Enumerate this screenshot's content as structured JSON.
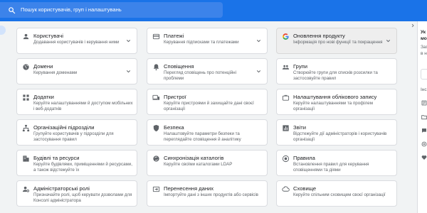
{
  "search": {
    "placeholder": "Пошук користувачів, груп і налаштувань",
    "icon": "search-icon"
  },
  "colors": {
    "header": "#1a73e8",
    "icon": "#5f6368",
    "highlight_card": "#eeeeee"
  },
  "cards": [
    {
      "title": "Користувачі",
      "description": "Додавання користувачів і керування ними",
      "icon": "person-icon",
      "expandable": true
    },
    {
      "title": "Платежі",
      "description": "Керування підписками та платежами",
      "icon": "credit-card-icon",
      "expandable": true
    },
    {
      "title": "Оновлення продукту",
      "description": "Інформація про нові функції та покращення",
      "icon": "google-logo-icon",
      "expandable": true,
      "highlighted": true
    },
    {
      "title": "Домени",
      "description": "Керування доменами",
      "icon": "globe-icon",
      "expandable": true
    },
    {
      "title": "Сповіщення",
      "description": "Перегляд сповіщень про потенційні проблеми",
      "icon": "bell-icon",
      "expandable": true
    },
    {
      "title": "Групи",
      "description": "Створюйте групи для списків розсилки та застосовуйте правил",
      "icon": "groups-icon",
      "expandable": false
    },
    {
      "title": "Додатки",
      "description": "Керуйте налаштуваннями й доступом мобільних і веб-додатків",
      "icon": "apps-grid-icon",
      "expandable": false
    },
    {
      "title": "Пристрої",
      "description": "Керуйте пристроями й захищайте дані своєї організації",
      "icon": "devices-icon",
      "expandable": false
    },
    {
      "title": "Налаштування облікового запису",
      "description": "Керуйте налаштуваннями та профілем організації",
      "icon": "briefcase-icon",
      "expandable": false
    },
    {
      "title": "Організаційні підрозділи",
      "description": "Групуйте користувачів у підрозділи для застосування правил",
      "icon": "org-chart-icon",
      "expandable": false
    },
    {
      "title": "Безпека",
      "description": "Налаштовуйте параметри безпеки та переглядайте сповіщення й аналітику",
      "icon": "shield-icon",
      "expandable": false
    },
    {
      "title": "Звіти",
      "description": "Відстежуйте дії адміністраторів і користувачів організації",
      "icon": "bar-chart-icon",
      "expandable": false
    },
    {
      "title": "Будівлі та ресурси",
      "description": "Керуйте будівлями, приміщеннями й ресурсами, а також відстежуйте їх",
      "icon": "building-icon",
      "expandable": false
    },
    {
      "title": "Синхронізація каталогів",
      "description": "Керуйте своїми каталогами LDAP",
      "icon": "sync-icon",
      "expandable": false
    },
    {
      "title": "Правила",
      "description": "Встановлення правил для керування сповіщеннями та діями",
      "icon": "rule-icon",
      "expandable": false
    },
    {
      "title": "Адміністраторські ролі",
      "description": "Призначайте ролі, щоб керувати дозволами для Консолі адміністратора",
      "icon": "admin-person-icon",
      "expandable": false
    },
    {
      "title": "Перенесення даних",
      "description": "Імпортуйте дані з інших продуктів або сервісів",
      "icon": "migration-icon",
      "expandable": false
    },
    {
      "title": "Сховище",
      "description": "Керуйте спільним сховищем своєї організації",
      "icon": "cloud-icon",
      "expandable": false
    }
  ],
  "side_panel": {
    "heading_fragments": [
      "Ук",
      "мо"
    ],
    "text_fragments": [
      "Заг",
      "в н",
      "Інс"
    ],
    "icons": [
      "article-icon",
      "folder-icon",
      "chat-icon",
      "add-circle-icon",
      "heart-icon"
    ]
  }
}
